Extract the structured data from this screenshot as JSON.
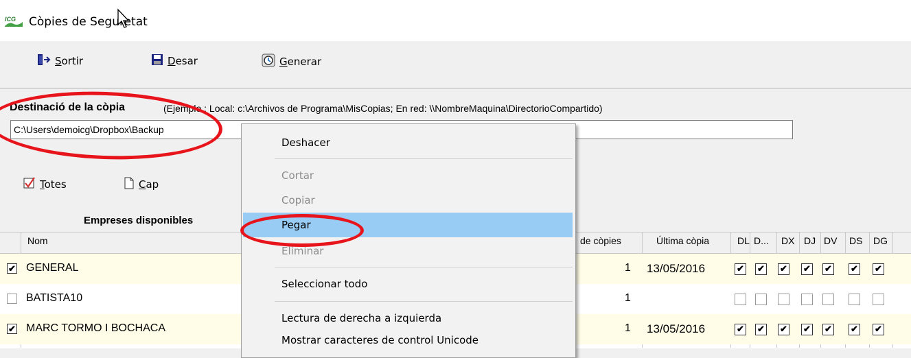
{
  "window": {
    "title": "Còpies de Seguretat",
    "logo_text": "ICG"
  },
  "toolbar": {
    "sortir": {
      "prefix": "",
      "ul": "S",
      "rest": "ortir",
      "icon": "exit-door-icon"
    },
    "desar": {
      "ul": "D",
      "rest": "esar",
      "icon": "floppy-disk-icon"
    },
    "generar": {
      "ul": "G",
      "rest": "enerar",
      "icon": "generate-clock-icon"
    }
  },
  "destination": {
    "label": "Destinació de la còpia",
    "example": "(Ejemplo : Local: c:\\Archivos de Programa\\MisCopias;  En red: \\\\NombreMaquina\\DirectorioCompartido)",
    "value": "C:\\Users\\demoicg\\Dropbox\\Backup"
  },
  "selection": {
    "totes": {
      "ul": "T",
      "rest": "otes"
    },
    "cap": {
      "ul": "C",
      "rest": "ap"
    }
  },
  "grid": {
    "title": "Empreses disponibles",
    "columns": {
      "nom": "Nom",
      "copies": "de còpies",
      "ultima": "Última còpia",
      "days": [
        "DL",
        "D...",
        "DX",
        "DJ",
        "DV",
        "DS",
        "DG"
      ]
    },
    "rows": [
      {
        "checked": true,
        "name": "GENERAL",
        "copies": "1",
        "last": "13/05/2016",
        "days": [
          true,
          true,
          true,
          true,
          true,
          true,
          true
        ]
      },
      {
        "checked": false,
        "name": "BATISTA10",
        "copies": "1",
        "last": "",
        "days": [
          false,
          false,
          false,
          false,
          false,
          false,
          false
        ]
      },
      {
        "checked": true,
        "name": "MARC TORMO I BOCHACA",
        "copies": "1",
        "last": "13/05/2016",
        "days": [
          true,
          true,
          true,
          true,
          true,
          true,
          true
        ]
      }
    ]
  },
  "context_menu": {
    "deshacer": "Deshacer",
    "cortar": "Cortar",
    "copiar": "Copiar",
    "pegar": "Pegar",
    "eliminar": "Eliminar",
    "seleccionar_todo": "Seleccionar todo",
    "lectura": "Lectura de derecha a izquierda",
    "mostrar": "Mostrar caracteres de control Unicode"
  },
  "colors": {
    "highlight": "#e8141b",
    "menu_selection": "#99ccf5",
    "row_yellow": "#fffde7"
  }
}
